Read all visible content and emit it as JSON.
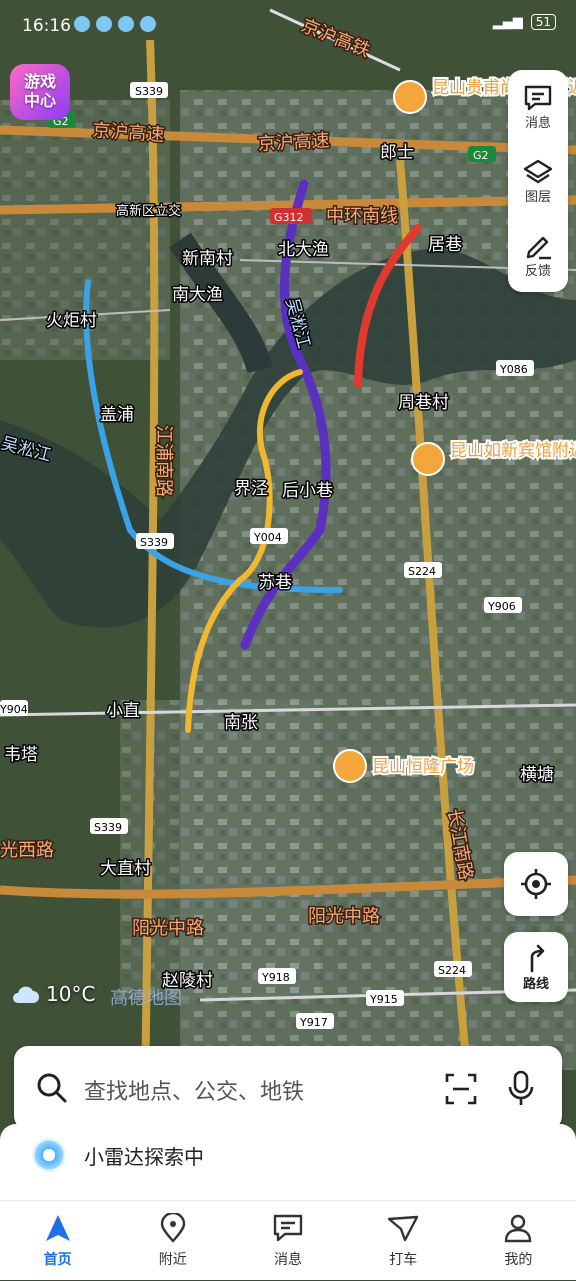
{
  "status": {
    "time": "16:16",
    "battery": "51"
  },
  "game_badge": {
    "line1": "游戏",
    "line2": "中心"
  },
  "side_panel": {
    "messages": "消息",
    "layers": "图层",
    "feedback": "反馈"
  },
  "locate_button": {
    "icon": "locate-icon"
  },
  "route_button": {
    "label": "路线"
  },
  "weather": {
    "temp": "10°C",
    "icon": "cloud-icon"
  },
  "map_watermark": "高德地图",
  "search": {
    "placeholder": "查找地点、公交、地铁"
  },
  "radar": {
    "label": "小雷达探索中"
  },
  "nav": {
    "home": "首页",
    "nearby": "附近",
    "messages": "消息",
    "taxi": "打车",
    "mine": "我的"
  },
  "map": {
    "highways": {
      "jinghu_gaotie": "京沪高铁",
      "jinghu_gaosu1": "京沪高速",
      "jinghu_gaosu2": "京沪高速",
      "zhonghuan": "中环南线",
      "yangguang1": "阳光中路",
      "yangguang2": "阳光中路",
      "jiangpu": "江浦南路",
      "changjiang": "长江南路",
      "guangxi": "光西路"
    },
    "places": {
      "langshi": "郎士",
      "gaoxin": "高新区立交",
      "xinnan": "新南村",
      "beidayu": "北大渔",
      "juxiang": "居巷",
      "nandayu": "南大渔",
      "huoju": "火炬村",
      "zhouxiang": "周巷村",
      "gaipu": "盖浦",
      "jiezhu": "界泾",
      "houxiaoxiang": "后小巷",
      "suxiang": "苏巷",
      "xiaozhi": "小直",
      "nanzhang": "南张",
      "weita": "韦塔",
      "dazhi": "大直村",
      "hengtang": "横塘",
      "zhaoling": "赵陵村",
      "wusong_l": "吴淞江",
      "wusong_c": "吴淞江"
    },
    "pois": {
      "kunshan_hotel": "昆山贵甫尚酒店附近",
      "rx_hotel": "昆山如新宾馆附近",
      "henglong": "昆山恒隆广场"
    },
    "shields": {
      "s339a": "S339",
      "g2a": "G2",
      "g2b": "G2",
      "g312": "G312",
      "y086": "Y086",
      "y004": "Y004",
      "s339b": "S339",
      "s224a": "S224",
      "y906": "Y906",
      "y904": "Y904",
      "s339c": "S339",
      "y918": "Y918",
      "y915": "Y915",
      "y917": "Y917",
      "s224b": "S224"
    }
  }
}
